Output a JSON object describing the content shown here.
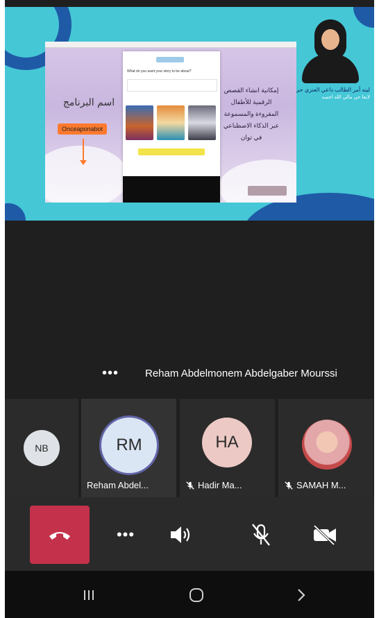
{
  "shared_screen": {
    "presenter_caption_line1": "لينه أمر الطالب داعي العنزي حي",
    "presenter_caption_line2": "لايعا حي مالي الله احسد",
    "slide": {
      "program_label": "اسم البرنامج",
      "app_tag": "Onceaponabot",
      "web_question": "What do you want your story to be about?",
      "arabic_text": "إمكانية انشاء القصص الرقمية للأطفال المقروءة والمسموعة عبر الذكاء الاصطناعي في ثوان"
    }
  },
  "active_speaker": {
    "more_label": "•••",
    "name": "Reham Abdelmonem Abdelgaber  Mourssi"
  },
  "participants": [
    {
      "initials": "NB",
      "label": "",
      "muted": false
    },
    {
      "initials": "RM",
      "label": "Reham Abdel...",
      "muted": false
    },
    {
      "initials": "HA",
      "label": "Hadir Ma...",
      "muted": true
    },
    {
      "initials": "",
      "label": "SAMAH M...",
      "muted": true
    }
  ],
  "controls": {
    "more_label": "•••",
    "hangup_icon": "phone-hangup-icon",
    "speaker_icon": "speaker-icon",
    "mic_icon": "mic-off-icon",
    "camera_icon": "camera-off-icon",
    "hangup_color": "#c4314b"
  },
  "android_nav": {
    "recent_icon": "recent-apps-icon",
    "home_icon": "home-icon",
    "back_icon": "back-icon"
  },
  "colors": {
    "teams_accent": "#6264a7",
    "slide_background": "#45c7d6",
    "blob": "#1f5aa6"
  }
}
